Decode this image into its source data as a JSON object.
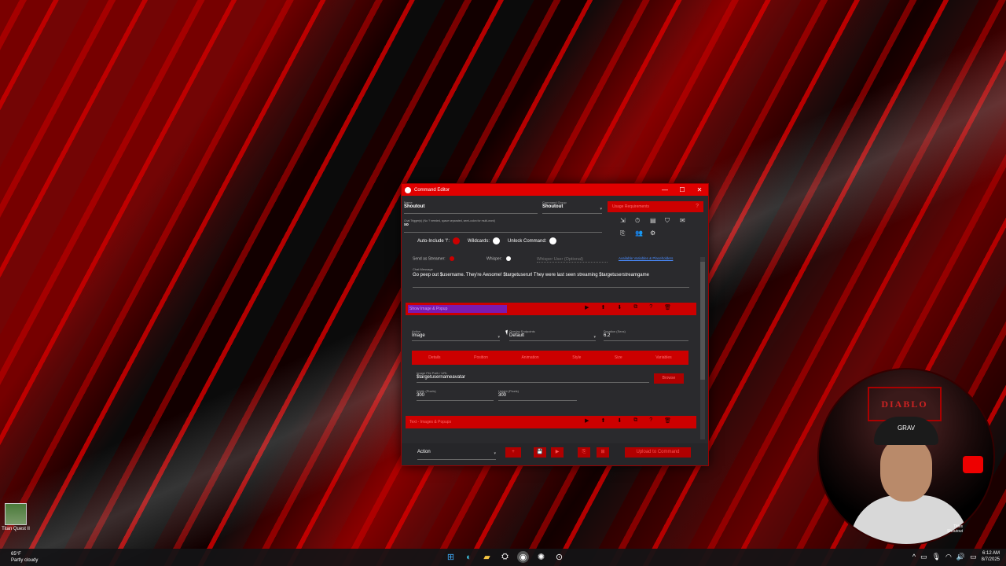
{
  "desktop": {
    "icon_label": "Titan Quest II"
  },
  "taskbar": {
    "weather_temp": "65°F",
    "weather_desc": "Partly cloudy",
    "time": "6:12 AM",
    "date": "8/7/2025",
    "apps": [
      "windows-start-icon",
      "edge-icon",
      "file-explorer-icon",
      "steam-icon",
      "streamer-bot-icon",
      "chatgpt-icon",
      "capture-icon"
    ]
  },
  "webcam": {
    "logo_text": "DIABLO",
    "cap_text": "GRAV",
    "caption_line1": "Titles",
    "caption_line2": "Shoutout"
  },
  "window": {
    "title": "Command Editor",
    "name_label": "Name",
    "name_value": "Shoutout",
    "group_label": "Command Group",
    "group_value": "Shoutout",
    "trigger_label": "Chat Trigger(s) (No '!' needed, space separated, semi-colon for multi-word)",
    "trigger_value": "so",
    "auto_include_label": "Auto-Include '!':",
    "wildcards_label": "Wildcards:",
    "unlock_label": "Unlock Command:",
    "requirements_label": "Usage Requirements",
    "requirements_help": "?",
    "send_streamer_label": "Send as Streamer:",
    "whisper_label": "Whisper:",
    "whisper_user_placeholder": "Whisper User (Optional)",
    "variables_link": "Available Variables & Placeholders",
    "chat_message_label": "Chat Message",
    "chat_message": "Go peep out $username. They're Awsome! $targetuserurl They were last seen streaming $targetuserstreamgame",
    "action1_name": "Show Image & Popup",
    "action_label": "Action",
    "action_value": "Image",
    "endpoints_label": "Overlay Endpoints",
    "endpoints_value": "Default",
    "duration_label": "Duration (Secs)",
    "duration_value": "6.2",
    "tabs": [
      "Details",
      "Position",
      "Animation",
      "Style",
      "Size",
      "Variables"
    ],
    "image_path_label": "Image File Path / URL",
    "image_path_value": "$targetusernameavatar",
    "browse_label": "Browse",
    "width_label": "Width (Pixels)",
    "width_value": "300",
    "height_label": "Height (Pixels)",
    "height_value": "300",
    "action2_name": "Text - Images & Popups",
    "bottom_action_value": "Action",
    "bottom_add": "+",
    "upload_label": "Upload to Command"
  },
  "colors": {
    "accent_red": "#cc0000",
    "title_red": "#e00000",
    "purple_highlight": "#7a1ab0"
  }
}
